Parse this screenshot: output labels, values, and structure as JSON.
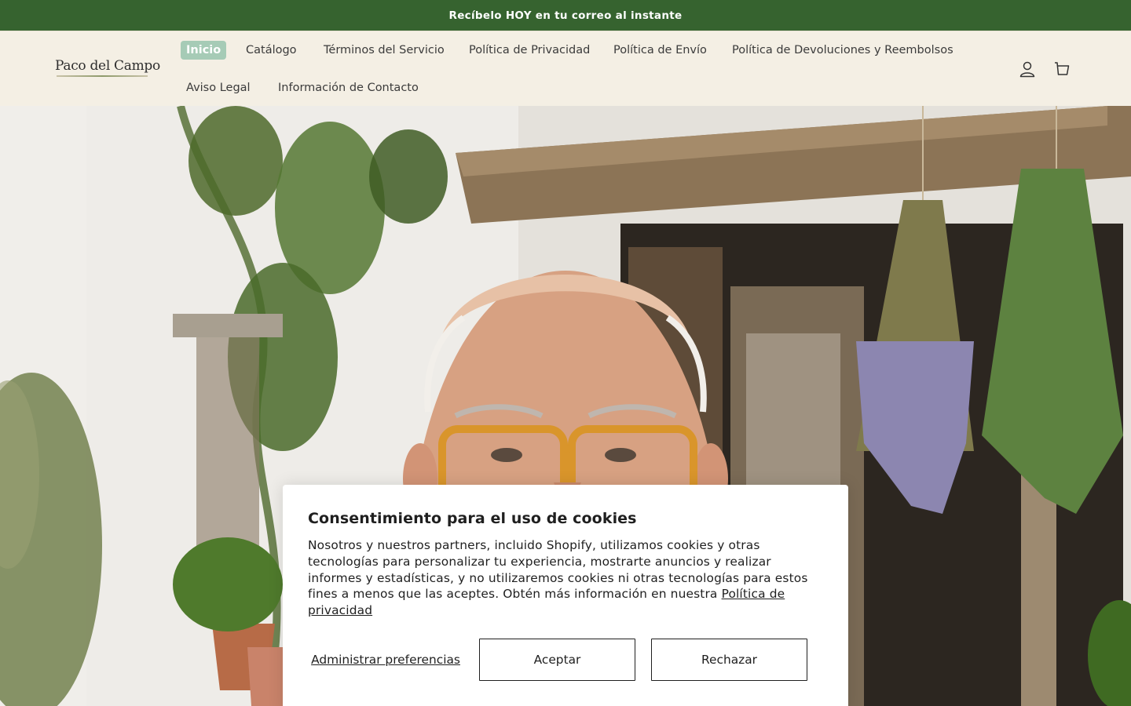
{
  "announcement": {
    "text": "Recíbelo HOY en tu correo al instante"
  },
  "header": {
    "logo_text": "Paco del Campo",
    "nav": [
      {
        "label": "Inicio",
        "active": true
      },
      {
        "label": "Catálogo"
      },
      {
        "label": "Términos del Servicio"
      },
      {
        "label": "Política de Privacidad"
      },
      {
        "label": "Política de Envío"
      },
      {
        "label": "Política de Devoluciones y Reembolsos"
      },
      {
        "label": "Aviso Legal"
      },
      {
        "label": "Información de Contacto"
      }
    ],
    "icons": [
      "account-icon",
      "cart-icon"
    ]
  },
  "cookie_banner": {
    "title": "Consentimiento para el uso de cookies",
    "body": "Nosotros y nuestros partners, incluido Shopify, utilizamos cookies y otras tecnologías para personalizar tu experiencia, mostrarte anuncios y realizar informes y estadísticas, y no utilizaremos cookies ni otras tecnologías para estos fines a menos que las aceptes. Obtén más información en nuestra",
    "policy_link": "Política de privacidad",
    "manage_label": "Administrar preferencias",
    "accept_label": "Aceptar",
    "reject_label": "Rechazar"
  },
  "colors": {
    "announcement_bg": "#36632f",
    "header_bg": "#f4efe4",
    "active_nav_bg": "#a6cbb6"
  }
}
